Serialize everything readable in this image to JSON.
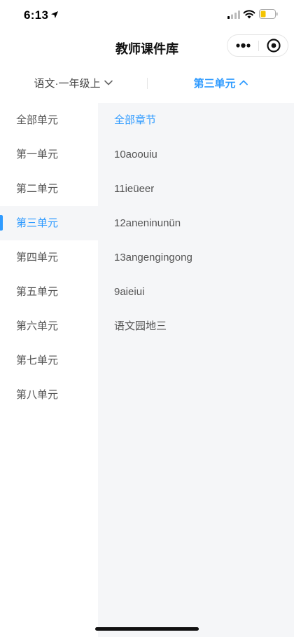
{
  "status_bar": {
    "time": "6:13",
    "battery_color": "#f5c400"
  },
  "nav": {
    "title": "教师课件库"
  },
  "filter": {
    "textbook": "语文·一年级上",
    "unit": "第三单元",
    "accent_color": "#2f9bff"
  },
  "sidebar": {
    "items": [
      {
        "label": "全部单元"
      },
      {
        "label": "第一单元"
      },
      {
        "label": "第二单元"
      },
      {
        "label": "第三单元"
      },
      {
        "label": "第四单元"
      },
      {
        "label": "第五单元"
      },
      {
        "label": "第六单元"
      },
      {
        "label": "第七单元"
      },
      {
        "label": "第八单元"
      }
    ],
    "active_label": "第三单元"
  },
  "chapters": {
    "items": [
      {
        "label": "全部章节"
      },
      {
        "label": "10aoouiu"
      },
      {
        "label": "11ieüeer"
      },
      {
        "label": "12aneninunün"
      },
      {
        "label": "13angengingong"
      },
      {
        "label": "9aieiui"
      },
      {
        "label": "语文园地三"
      }
    ],
    "active_label": "全部章节"
  }
}
